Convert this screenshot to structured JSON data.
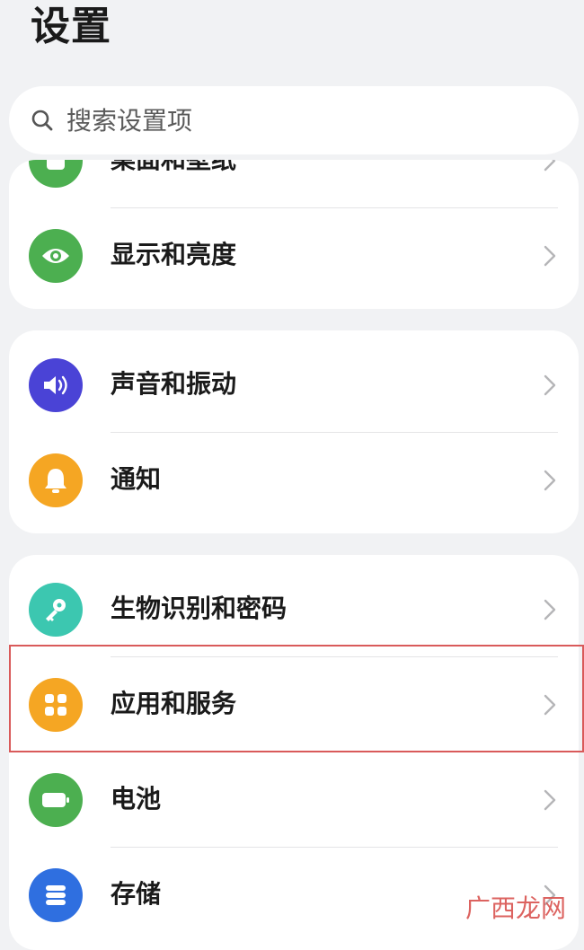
{
  "header": {
    "title": "设置"
  },
  "search": {
    "placeholder": "搜索设置项"
  },
  "groups": [
    {
      "items": [
        {
          "label": "桌面和壁纸",
          "icon": "wallpaper-icon",
          "color": "#4caf50"
        },
        {
          "label": "显示和亮度",
          "icon": "eye-icon",
          "color": "#4caf50"
        }
      ]
    },
    {
      "items": [
        {
          "label": "声音和振动",
          "icon": "speaker-icon",
          "color": "#4a43d6"
        },
        {
          "label": "通知",
          "icon": "bell-icon",
          "color": "#f5a623"
        }
      ]
    },
    {
      "items": [
        {
          "label": "生物识别和密码",
          "icon": "key-icon",
          "color": "#3cc7b0"
        },
        {
          "label": "应用和服务",
          "icon": "apps-icon",
          "color": "#f5a623"
        },
        {
          "label": "电池",
          "icon": "battery-icon",
          "color": "#4caf50"
        },
        {
          "label": "存储",
          "icon": "storage-icon",
          "color": "#2f6fe0"
        }
      ]
    }
  ],
  "watermark": {
    "text": "广西龙网"
  },
  "colors": {
    "background": "#f1f2f4",
    "card": "#ffffff",
    "highlight": "#d95a5a"
  }
}
